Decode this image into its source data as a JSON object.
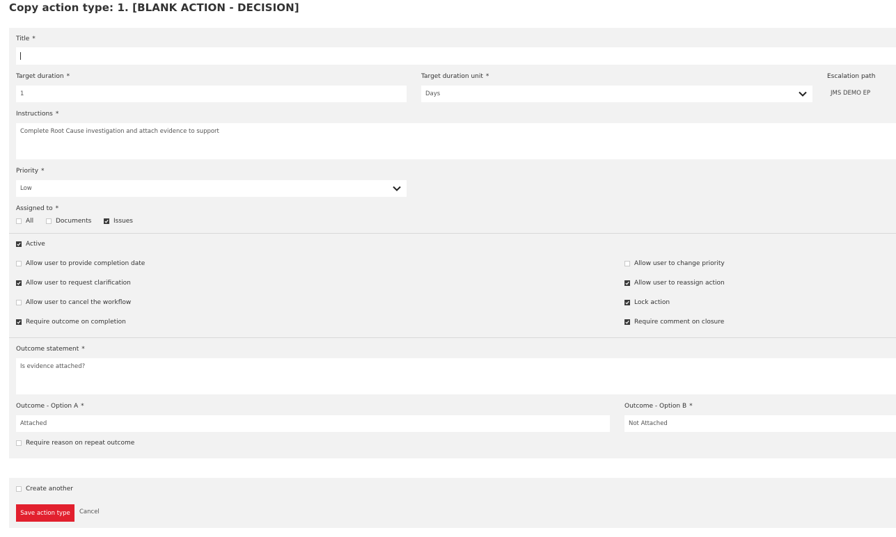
{
  "page": {
    "title": "Copy action type: 1. [BLANK ACTION - DECISION]"
  },
  "form": {
    "title": {
      "label": "Title",
      "required": "*",
      "value": ""
    },
    "target_duration": {
      "label": "Target duration",
      "required": "*",
      "value": "1"
    },
    "target_duration_unit": {
      "label": "Target duration unit",
      "required": "*",
      "value": "Days"
    },
    "escalation_path": {
      "label": "Escalation path",
      "value": "JMS DEMO EP"
    },
    "instructions": {
      "label": "Instructions",
      "required": "*",
      "value": "Complete Root Cause investigation and attach evidence to support"
    },
    "priority": {
      "label": "Priority",
      "required": "*",
      "value": "Low"
    },
    "assigned_to": {
      "label": "Assigned to",
      "required": "*",
      "options": [
        {
          "label": "All",
          "checked": false
        },
        {
          "label": "Documents",
          "checked": false
        },
        {
          "label": "Issues",
          "checked": true
        }
      ]
    },
    "active": {
      "label": "Active",
      "checked": true
    },
    "permissions_left": [
      {
        "label": "Allow user to provide completion date",
        "checked": false
      },
      {
        "label": "Allow user to request clarification",
        "checked": true
      },
      {
        "label": "Allow user to cancel the workflow",
        "checked": false
      },
      {
        "label": "Require outcome on completion",
        "checked": true
      }
    ],
    "permissions_right": [
      {
        "label": "Allow user to change priority",
        "checked": false
      },
      {
        "label": "Allow user to reassign action",
        "checked": true
      },
      {
        "label": "Lock action",
        "checked": true
      },
      {
        "label": "Require comment on closure",
        "checked": true
      }
    ],
    "outcome_statement": {
      "label": "Outcome statement",
      "required": "*",
      "value": "Is evidence attached?"
    },
    "outcome_a": {
      "label": "Outcome - Option A",
      "required": "*",
      "value": "Attached"
    },
    "outcome_b": {
      "label": "Outcome - Option B",
      "required": "*",
      "value": "Not Attached"
    },
    "require_reason": {
      "label": "Require reason on repeat outcome",
      "checked": false
    }
  },
  "footer": {
    "create_another": {
      "label": "Create another",
      "checked": false
    },
    "save_label": "Save action type",
    "cancel_label": "Cancel"
  },
  "icons": {
    "dropdown": "chevron-down-icon",
    "check": "check-icon"
  },
  "colors": {
    "primary": "#e2202e",
    "panel": "#f2f2f2"
  }
}
